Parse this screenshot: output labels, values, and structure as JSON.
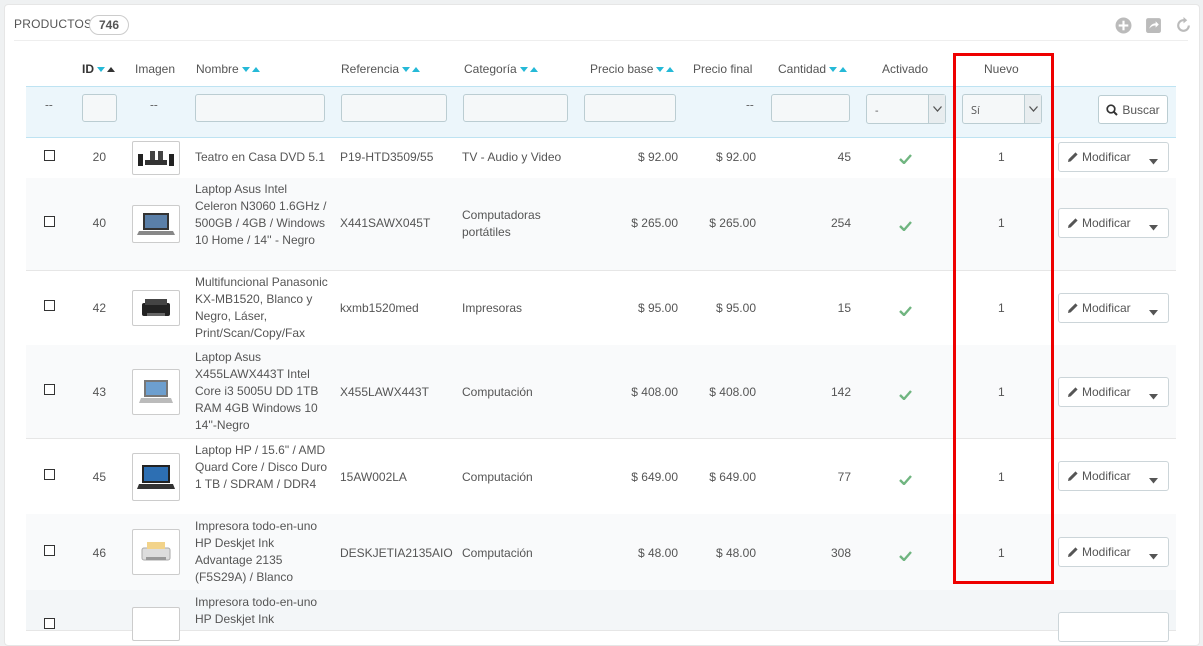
{
  "header": {
    "title": "PRODUCTOS",
    "count": "746",
    "tools": [
      "add-icon",
      "export-icon",
      "refresh-icon"
    ]
  },
  "columns": {
    "id": "ID",
    "image": "Imagen",
    "name": "Nombre",
    "reference": "Referencia",
    "category": "Categoría",
    "base_price": "Precio base",
    "final_price": "Precio final",
    "quantity": "Cantidad",
    "active": "Activado",
    "new": "Nuevo"
  },
  "filters": {
    "id_dash": "--",
    "image_dash": "--",
    "final_price_dash": "--",
    "active_value": "-",
    "new_value": "Sí",
    "search_label": "Buscar"
  },
  "rows": [
    {
      "id": "20",
      "name": "Teatro en Casa DVD 5.1",
      "reference": "P19-HTD3509/55",
      "category": "TV - Audio y Video",
      "base": "$ 92.00",
      "final": "$ 92.00",
      "qty": "45",
      "new": "1",
      "action": "Modificar"
    },
    {
      "id": "40",
      "name": "Laptop Asus Intel Celeron N3060 1.6GHz / 500GB / 4GB / Windows 10 Home / 14'' - Negro",
      "reference": "X441SAWX045T",
      "category": "Computadoras portátiles",
      "base": "$ 265.00",
      "final": "$ 265.00",
      "qty": "254",
      "new": "1",
      "action": "Modificar"
    },
    {
      "id": "42",
      "name": "Multifuncional Panasonic KX-MB1520, Blanco y Negro, Láser, Print/Scan/Copy/Fax",
      "reference": "kxmb1520med",
      "category": "Impresoras",
      "base": "$ 95.00",
      "final": "$ 95.00",
      "qty": "15",
      "new": "1",
      "action": "Modificar"
    },
    {
      "id": "43",
      "name": "Laptop Asus X455LAWX443T Intel Core i3 5005U DD 1TB RAM 4GB Windows 10 14''-Negro",
      "reference": "X455LAWX443T",
      "category": "Computación",
      "base": "$ 408.00",
      "final": "$ 408.00",
      "qty": "142",
      "new": "1",
      "action": "Modificar"
    },
    {
      "id": "45",
      "name": "Laptop HP / 15.6\" / AMD Quard Core / Disco Duro 1 TB / SDRAM / DDR4",
      "reference": "15AW002LA",
      "category": "Computación",
      "base": "$ 649.00",
      "final": "$ 649.00",
      "qty": "77",
      "new": "1",
      "action": "Modificar"
    },
    {
      "id": "46",
      "name": "Impresora todo-en-uno HP Deskjet Ink Advantage 2135 (F5S29A) / Blanco",
      "reference": "DESKJETIA2135AIO",
      "category": "Computación",
      "base": "$ 48.00",
      "final": "$ 48.00",
      "qty": "308",
      "new": "1",
      "action": "Modificar"
    },
    {
      "id": "",
      "name": "Impresora todo-en-uno HP Deskjet Ink",
      "reference": "",
      "category": "",
      "base": "",
      "final": "",
      "qty": "",
      "new": "",
      "action": ""
    }
  ],
  "colors": {
    "accent": "#25b9d7",
    "highlight": "#e00000",
    "check": "#70b580",
    "filter_bg": "#ecf6fb"
  }
}
